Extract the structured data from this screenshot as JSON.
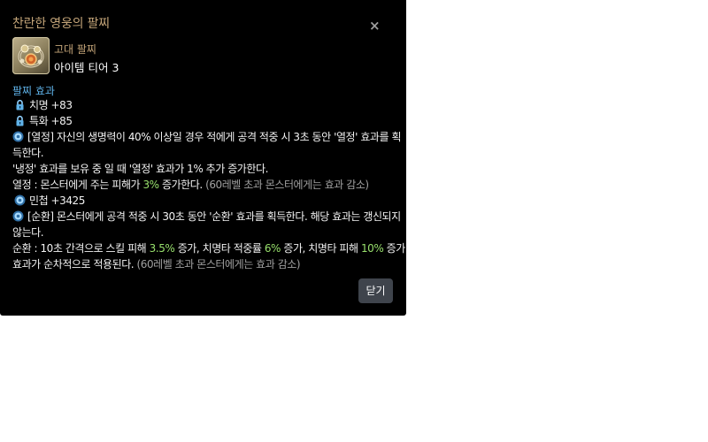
{
  "modal": {
    "title": "찬란한 영웅의 팔찌",
    "close_icon": "×",
    "item": {
      "icon": "bracelet-icon",
      "grade": "고대 팔찌",
      "tier": "아이템 티어 3"
    },
    "section_title": "팔찌 효과",
    "effects": {
      "crit": "치명 +83",
      "special": "특화 +85",
      "passion_line1": "[열정] 자신의 생명력이 40% 이상일 경우 적에게 공격 적중 시 3초 동안 '열정' 효과를 획",
      "passion_line2": "득한다.",
      "passion_line3": "'냉정' 효과를 보유 중 일 때 '열정' 효과가 1% 추가 증가한다.",
      "passion_detail_a": "열정 : 몬스터에게 주는 피해가 ",
      "passion_detail_val": "3%",
      "passion_detail_b": " 증가한다.",
      "passion_detail_note": " (60레벨 초과 몬스터에게는 효과 감소)",
      "swift": "민첩 +3425",
      "cycle_line1": "[순환] 몬스터에게 공격 적중 시 30초 동안 '순환' 효과를 획득한다. 해당 효과는 갱신되지",
      "cycle_line2": "않는다.",
      "cycle_detail_a": "순환 : 10초 간격으로 스킬 피해 ",
      "cycle_val1": "3.5%",
      "cycle_detail_b": " 증가, 치명타 적중률 ",
      "cycle_val2": "6%",
      "cycle_detail_c": " 증가, 치명타 피해 ",
      "cycle_val3": "10%",
      "cycle_detail_d": " 증가",
      "cycle_line4a": "효과가 순차적으로 적용된다.",
      "cycle_line4_note": " (60레벨 초과 몬스터에게는 효과 감소)"
    },
    "close_button": "닫기"
  },
  "icons": {
    "lock": "lock-icon",
    "effect": "gear-icon"
  },
  "colors": {
    "background": "#000000",
    "title": "#c3a478",
    "section": "#5fb2e8",
    "highlight": "#98e06c",
    "note": "#a0a0a0",
    "button": "#3f444c"
  }
}
